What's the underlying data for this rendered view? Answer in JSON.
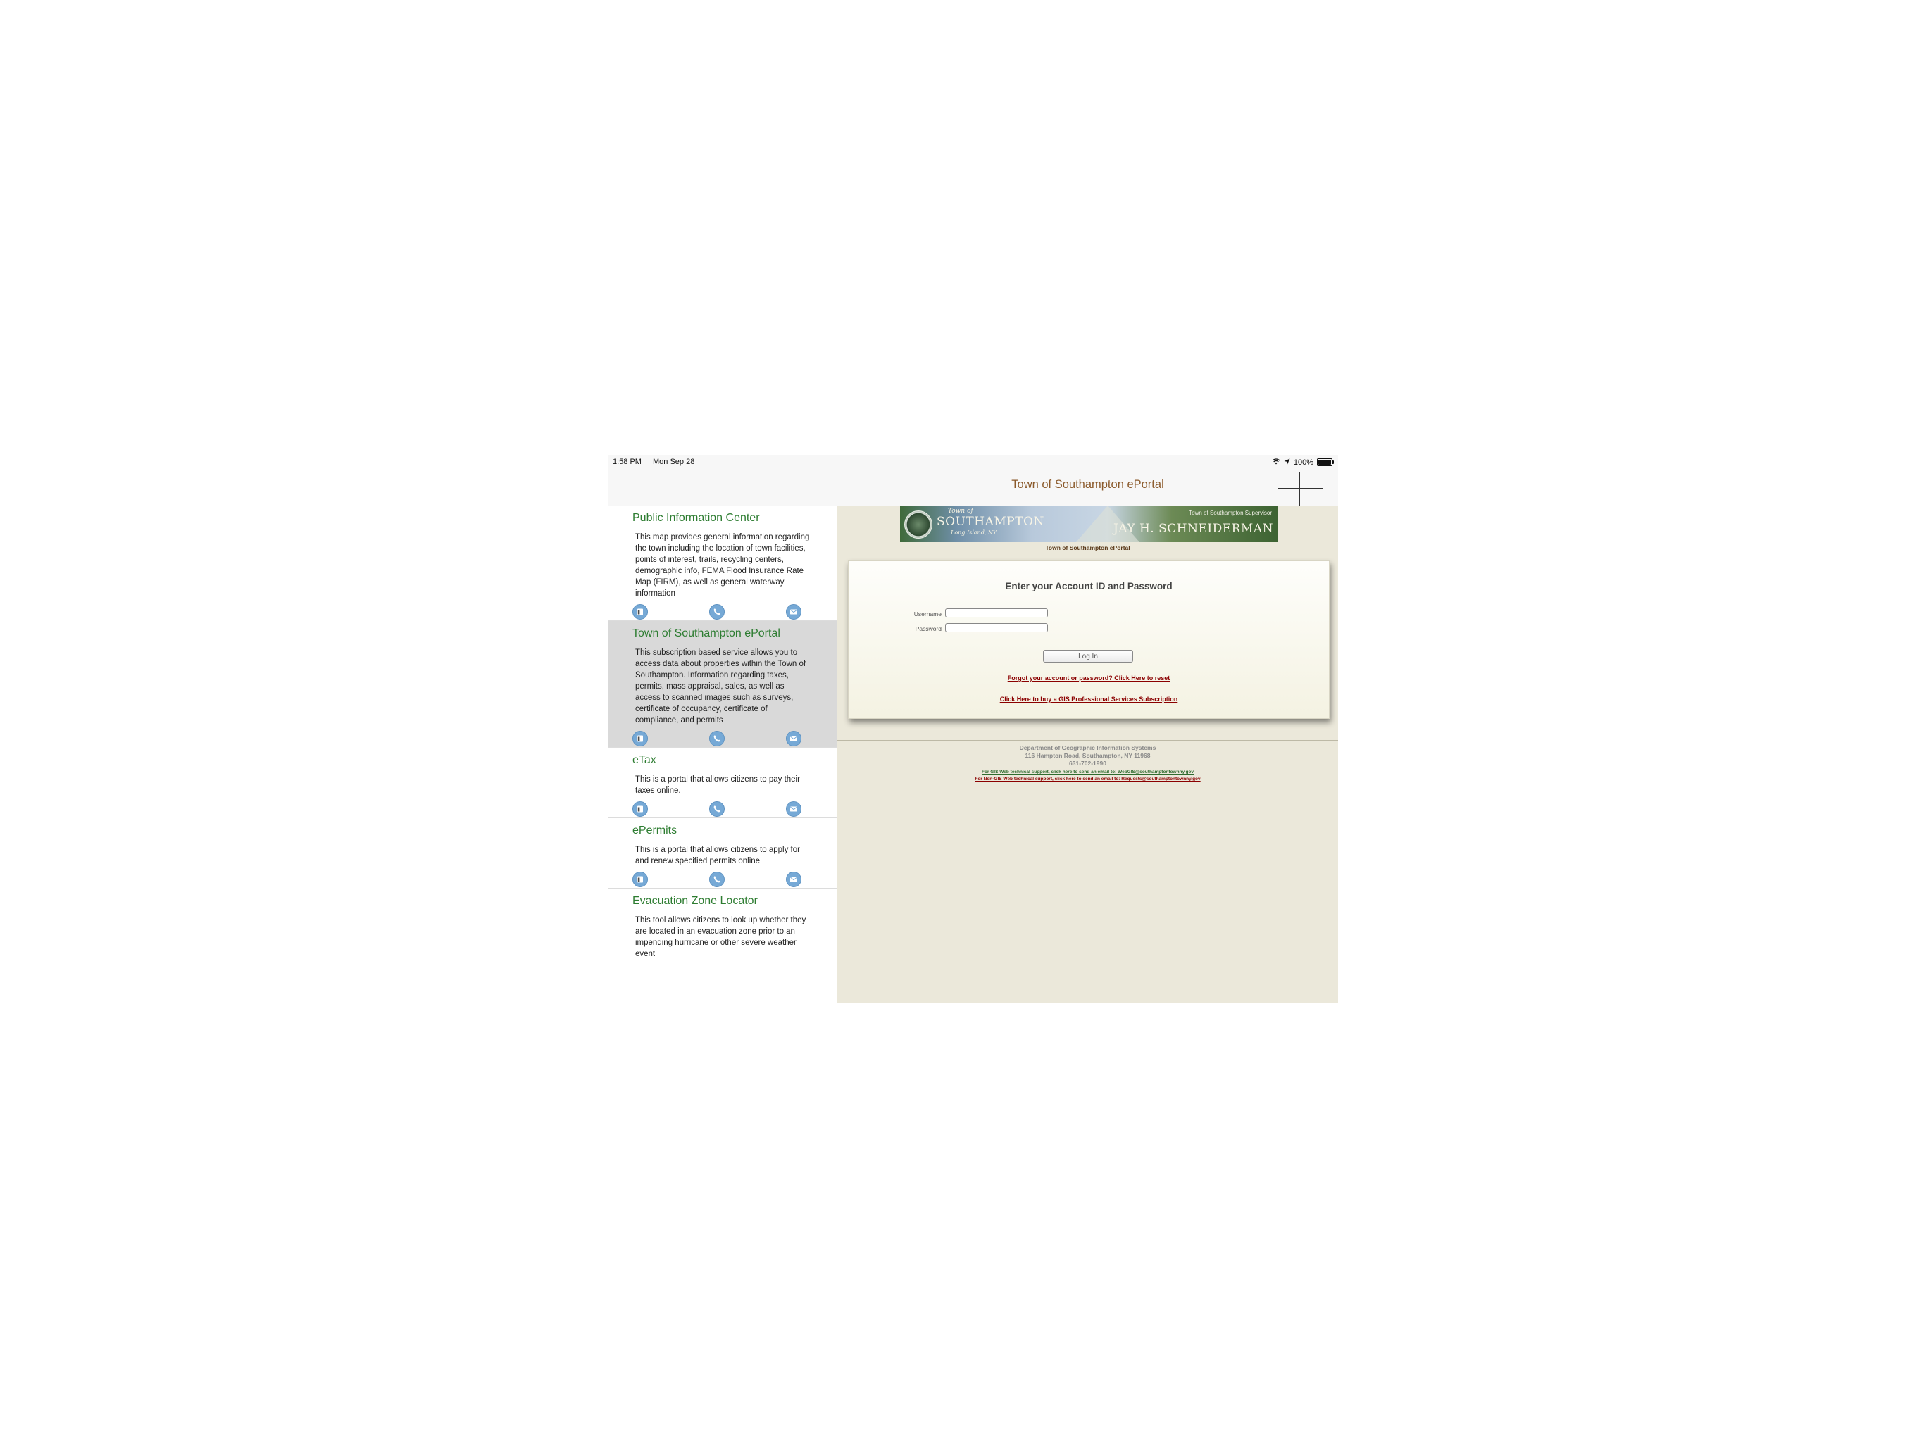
{
  "status_bar": {
    "time": "1:58 PM",
    "date": "Mon Sep 28",
    "battery": "100%",
    "icons": [
      "wifi-icon",
      "location-arrow-icon",
      "battery-icon"
    ]
  },
  "services": [
    {
      "title": "Public Information Center",
      "description": "This map provides general information regarding the town including the location of town facilities, points of interest, trails, recycling centers, demographic info, FEMA Flood Insurance Rate Map (FIRM), as well as general waterway information",
      "selected": false
    },
    {
      "title": "Town of Southampton ePortal",
      "description": "This subscription based service allows you to access data about properties within the Town of Southampton. Information regarding taxes, permits, mass appraisal, sales, as well as access to scanned images such as surveys, certificate of occupancy, certificate of compliance, and permits",
      "selected": true
    },
    {
      "title": "eTax",
      "description": "This is a portal that allows citizens to pay their taxes online.",
      "selected": false
    },
    {
      "title": "ePermits",
      "description": "This is a portal that allows citizens to apply for and renew specified permits online",
      "selected": false
    },
    {
      "title": "Evacuation Zone Locator",
      "description": "This tool allows citizens to look up whether they are located in an evacuation zone prior to an impending hurricane or other severe weather event",
      "selected": false
    }
  ],
  "action_icons": [
    "browser-icon",
    "phone-icon",
    "mail-icon"
  ],
  "detail": {
    "nav_title": "Town of Southampton ePortal",
    "banner": {
      "town_of": "Town of",
      "town_name": "SOUTHAMPTON",
      "subtitle": "Long Island, NY",
      "supervisor_label": "Town of Southampton Supervisor",
      "supervisor_name": "JAY H. SCHNEIDERMAN"
    },
    "banner_caption": "Town of Southampton ePortal",
    "login": {
      "heading": "Enter your Account ID and Password",
      "username_label": "Username",
      "username_value": "",
      "password_label": "Password",
      "password_value": "",
      "login_button": "Log In",
      "forgot_link": "Forgot your account or password? Click Here to reset",
      "subscription_link": "Click Here to buy a GIS Professional Services Subscription"
    },
    "footer": {
      "department": "Department of Geographic Information Systems",
      "address": "116 Hampton Road, Southampton, NY 11968",
      "phone": "631-702-1990",
      "gis_support_link": "For GIS Web technical support, click here to send an email to: WebGIS@southamptontownny.gov",
      "nongis_support_link": "For Non-GIS Web technical support, click here to send an email to: Requests@southamptontownny.gov"
    }
  },
  "colors": {
    "service_title": "#2e7d32",
    "nav_title": "#8b5a2b",
    "selected_row": "#d9d9d9",
    "action_button": "#76a9d6",
    "web_background": "#ebe8da",
    "link_red": "#8b0000",
    "link_green": "#2e6b2e"
  }
}
